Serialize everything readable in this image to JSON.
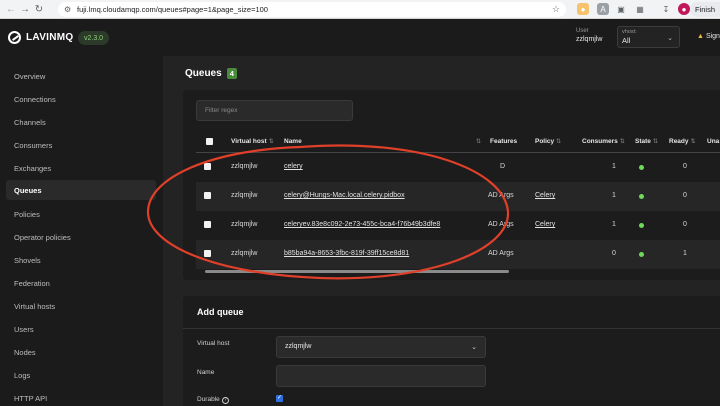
{
  "browser": {
    "url": "fuji.lmq.cloudamqp.com/queues#page=1&page_size=100",
    "profile_button": "Finish"
  },
  "header": {
    "logo": "LAVINMQ",
    "version": "v2.3.0",
    "user_label": "User",
    "user_value": "zzlqmjlw",
    "vhost_label": "vhost:",
    "vhost_value": "All",
    "signout": "Sign"
  },
  "sidebar": {
    "items": [
      {
        "label": "Overview"
      },
      {
        "label": "Connections"
      },
      {
        "label": "Channels"
      },
      {
        "label": "Consumers"
      },
      {
        "label": "Exchanges"
      },
      {
        "label": "Queues"
      },
      {
        "label": "Policies"
      },
      {
        "label": "Operator policies"
      },
      {
        "label": "Shovels"
      },
      {
        "label": "Federation"
      },
      {
        "label": "Virtual hosts"
      },
      {
        "label": "Users"
      },
      {
        "label": "Nodes"
      },
      {
        "label": "Logs"
      },
      {
        "label": "HTTP API"
      }
    ],
    "active": "Queues"
  },
  "queues": {
    "title": "Queues",
    "count": "4",
    "filter_placeholder": "Filter regex",
    "corner_text": "*",
    "columns": {
      "vhost": "Virtual host",
      "name": "Name",
      "features": "Features",
      "policy": "Policy",
      "consumers": "Consumers",
      "state": "State",
      "ready": "Ready",
      "unacked": "Una"
    },
    "rows": [
      {
        "vhost": "zzlqmjlw",
        "name": "celery",
        "features": "D",
        "policy": "",
        "consumers": "1",
        "ready": "0"
      },
      {
        "vhost": "zzlqmjlw",
        "name": "celery@Hungs-Mac.local.celery.pidbox",
        "features": "AD Args",
        "policy": "Celery",
        "consumers": "1",
        "ready": "0"
      },
      {
        "vhost": "zzlqmjlw",
        "name": "celeryev.83e8c092-2e73-455c-bca4-f76b49b3dfe8",
        "features": "AD Args",
        "policy": "Celery",
        "consumers": "1",
        "ready": "0"
      },
      {
        "vhost": "zzlqmjlw",
        "name": "b85ba94a-8653-3fbc-819f-39ff15ce8d81",
        "features": "AD Args",
        "policy": "",
        "consumers": "0",
        "ready": "1"
      }
    ]
  },
  "add_queue": {
    "title": "Add queue",
    "vhost_label": "Virtual host",
    "vhost_value": "zzlqmjlw",
    "name_label": "Name",
    "durable_label": "Durable"
  },
  "colors": {
    "state_running": "#6ed95a",
    "annotation": "#e0402a",
    "count_badge": "#4a8a3c"
  }
}
